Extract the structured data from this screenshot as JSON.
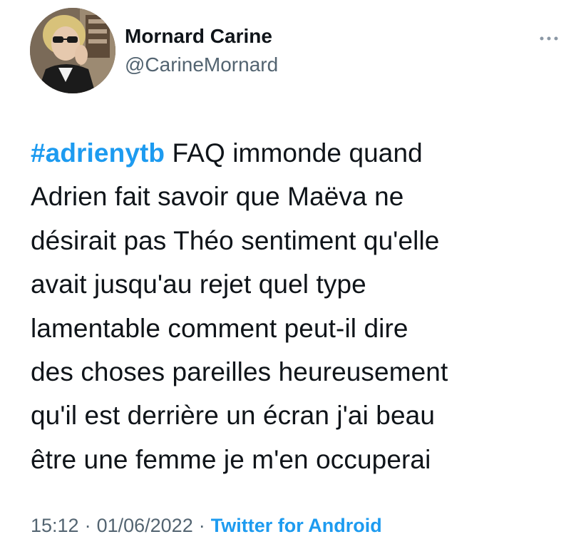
{
  "tweet": {
    "author": {
      "display_name": "Mornard Carine",
      "handle": "@CarineMornard"
    },
    "text": {
      "hashtag": "#adrienytb",
      "line1_rest": " FAQ immonde quand",
      "lines": [
        "Adrien fait savoir que Maëva ne",
        "désirait pas Théo sentiment qu'elle",
        "avait jusqu'au rejet quel type",
        "lamentable comment peut-il dire",
        "des choses pareilles heureusement",
        "qu'il est derrière un écran j'ai beau",
        "être une femme je m'en occuperai"
      ]
    },
    "meta": {
      "time": "15:12",
      "date": "01/06/2022",
      "separator": "·",
      "source": "Twitter for Android"
    }
  },
  "icons": {
    "more": "more-horizontal-icon"
  },
  "colors": {
    "link": "#1d9bf0",
    "secondary_text": "#536471",
    "primary_text": "#0f1419"
  }
}
